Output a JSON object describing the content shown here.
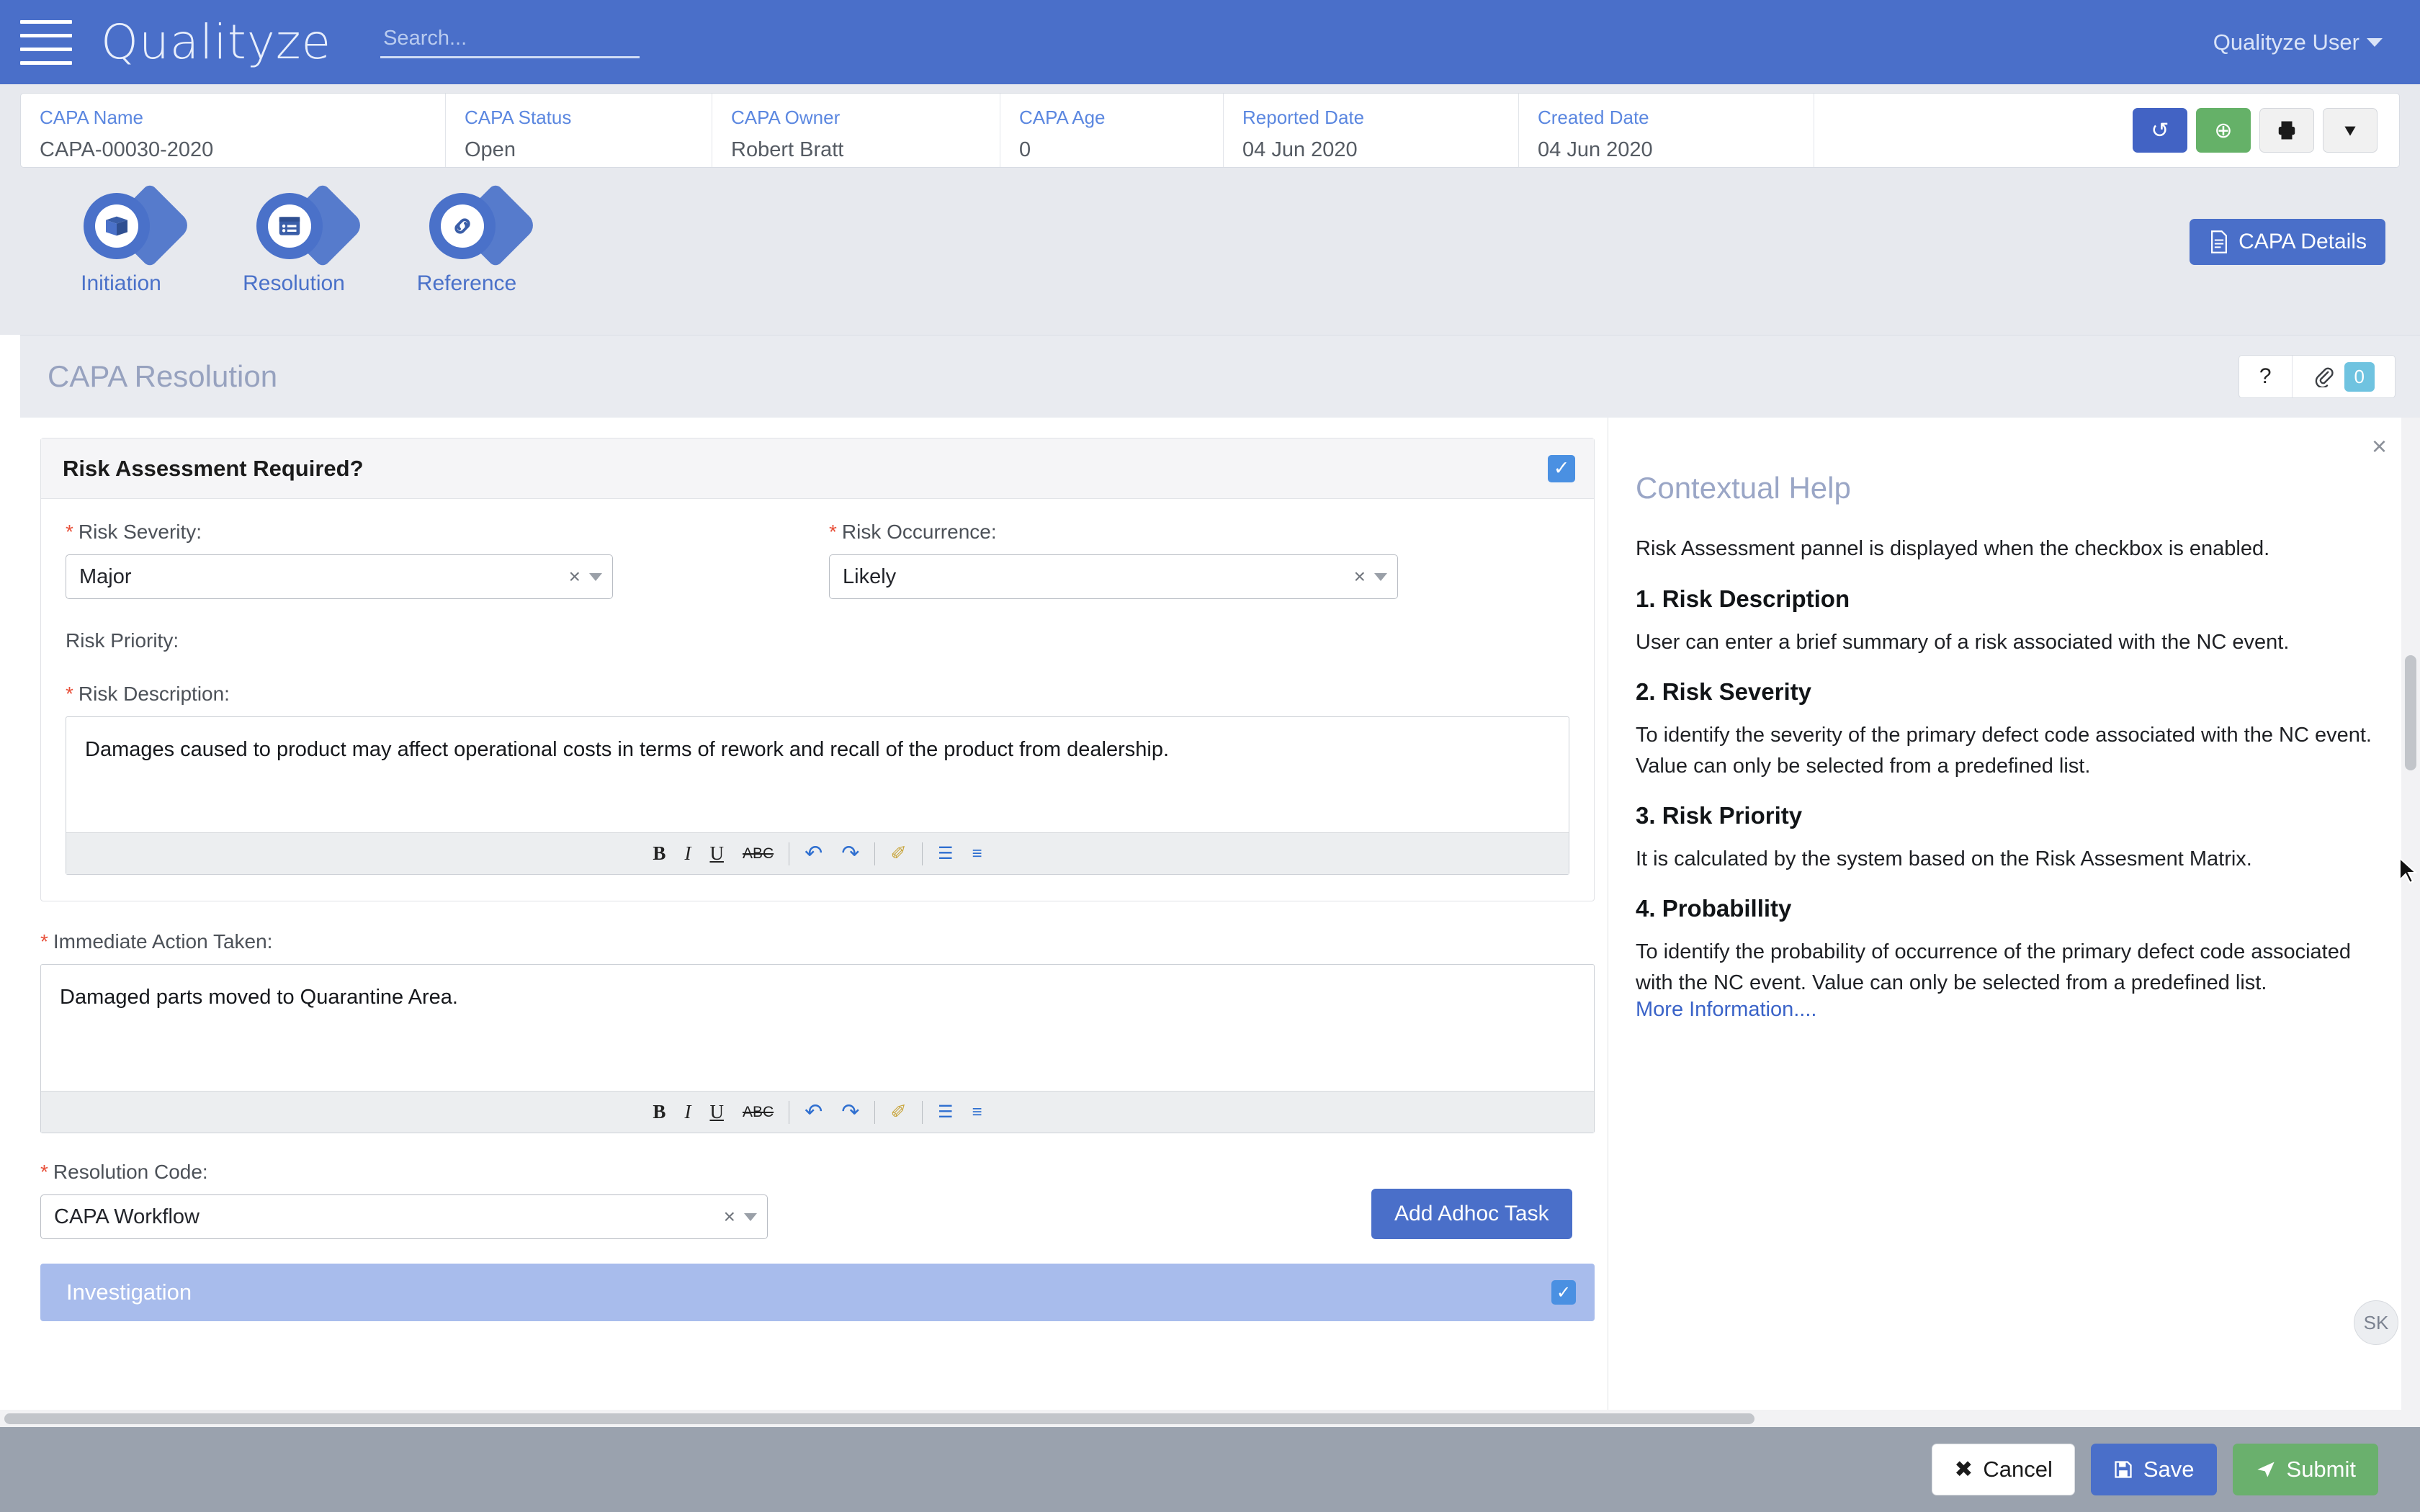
{
  "header": {
    "brand": "Qualityze",
    "menu_icon": "hamburger-icon",
    "search_placeholder": "Search...",
    "search_value": "",
    "user_label": "Qualityze User"
  },
  "record": {
    "fields": [
      {
        "label": "CAPA Name",
        "value": "CAPA-00030-2020"
      },
      {
        "label": "CAPA Status",
        "value": "Open"
      },
      {
        "label": "CAPA Owner",
        "value": "Robert Bratt"
      },
      {
        "label": "CAPA Age",
        "value": "0"
      },
      {
        "label": "Reported Date",
        "value": "04 Jun 2020"
      },
      {
        "label": "Created Date",
        "value": "04 Jun 2020"
      }
    ],
    "actions": [
      {
        "name": "history-button",
        "icon": "history-icon",
        "glyph": "↺",
        "style": "blue"
      },
      {
        "name": "add-button",
        "icon": "plus-circle-icon",
        "glyph": "⊕",
        "style": "green"
      },
      {
        "name": "print-button",
        "icon": "printer-icon",
        "glyph": "⎙",
        "style": "ghost"
      },
      {
        "name": "more-button",
        "icon": "chevron-down-icon",
        "glyph": "⌄",
        "style": "ghost"
      }
    ]
  },
  "tabs": [
    {
      "label": "Initiation",
      "icon": "package-initiation-icon"
    },
    {
      "label": "Resolution",
      "icon": "list-resolution-icon"
    },
    {
      "label": "Reference",
      "icon": "link-chain-icon"
    }
  ],
  "capa_details_button": {
    "label": "CAPA Details",
    "icon": "document-icon"
  },
  "section": {
    "title": "CAPA Resolution",
    "help_button_glyph": "?",
    "attachment_icon": "paperclip-icon",
    "attachment_count": "0"
  },
  "risk_card": {
    "title": "Risk Assessment Required?",
    "enabled": true,
    "checkbox_glyph": "✓",
    "severity": {
      "label": "Risk Severity:",
      "value": "Major",
      "required": true,
      "clear_glyph": "×"
    },
    "occurrence": {
      "label": "Risk Occurrence:",
      "value": "Likely",
      "required": true,
      "clear_glyph": "×"
    },
    "priority": {
      "label": "Risk Priority:",
      "value": "",
      "required": false
    },
    "description": {
      "label": "Risk Description:",
      "required": true,
      "value": "Damages caused to product may affect operational costs in terms of rework and recall of the product from dealership."
    }
  },
  "immediate_action": {
    "label": "Immediate Action Taken:",
    "required": true,
    "value": "Damaged parts moved to Quarantine Area."
  },
  "resolution_code": {
    "label": "Resolution Code:",
    "required": true,
    "value": "CAPA Workflow",
    "clear_glyph": "×"
  },
  "add_adhoc_task_button": {
    "label": "Add Adhoc Task"
  },
  "investigation": {
    "label": "Investigation",
    "enabled": true,
    "checkbox_glyph": "✓"
  },
  "editor_toolbar": [
    {
      "name": "bold-icon",
      "glyph": "B"
    },
    {
      "name": "italic-icon",
      "glyph": "I"
    },
    {
      "name": "underline-icon",
      "glyph": "U"
    },
    {
      "name": "strikethrough-icon",
      "glyph": "ABC"
    },
    {
      "name": "undo-icon",
      "glyph": "↶"
    },
    {
      "name": "redo-icon",
      "glyph": "↷"
    },
    {
      "name": "clear-format-icon",
      "glyph": "✐"
    },
    {
      "name": "bullet-list-icon",
      "glyph": "☰"
    },
    {
      "name": "numbered-list-icon",
      "glyph": "≡"
    }
  ],
  "help": {
    "title": "Contextual Help",
    "close_glyph": "×",
    "lead": "Risk Assessment pannel is displayed when the checkbox is enabled.",
    "sections": [
      {
        "heading": "1. Risk Description",
        "body": "User can enter a brief summary of a risk associated with the NC event."
      },
      {
        "heading": "2. Risk Severity",
        "body": "To identify the severity of the primary defect code associated with the NC event. Value can only be selected from a predefined list."
      },
      {
        "heading": "3. Risk Priority",
        "body": "It is calculated by the system based on the Risk Assesment Matrix."
      },
      {
        "heading": "4. Probabillity",
        "body": "To identify the probability of occurrence of the primary defect code associated with the NC event. Value can only be selected from a predefined list."
      }
    ],
    "more_link": "More Information...."
  },
  "avatar": {
    "initials": "SK"
  },
  "footer": {
    "cancel": {
      "label": "Cancel",
      "icon": "close-icon",
      "glyph": "✖"
    },
    "save": {
      "label": "Save",
      "icon": "floppy-disk-icon",
      "glyph": "💾"
    },
    "submit": {
      "label": "Submit",
      "icon": "paper-plane-icon",
      "glyph": "➤"
    }
  },
  "colors": {
    "brand_blue": "#4a6fc9",
    "accent_green": "#6ab06d",
    "required_red": "#e8503a",
    "badge_cyan": "#6fc3e0",
    "investigation_bar": "#a8bcec"
  }
}
